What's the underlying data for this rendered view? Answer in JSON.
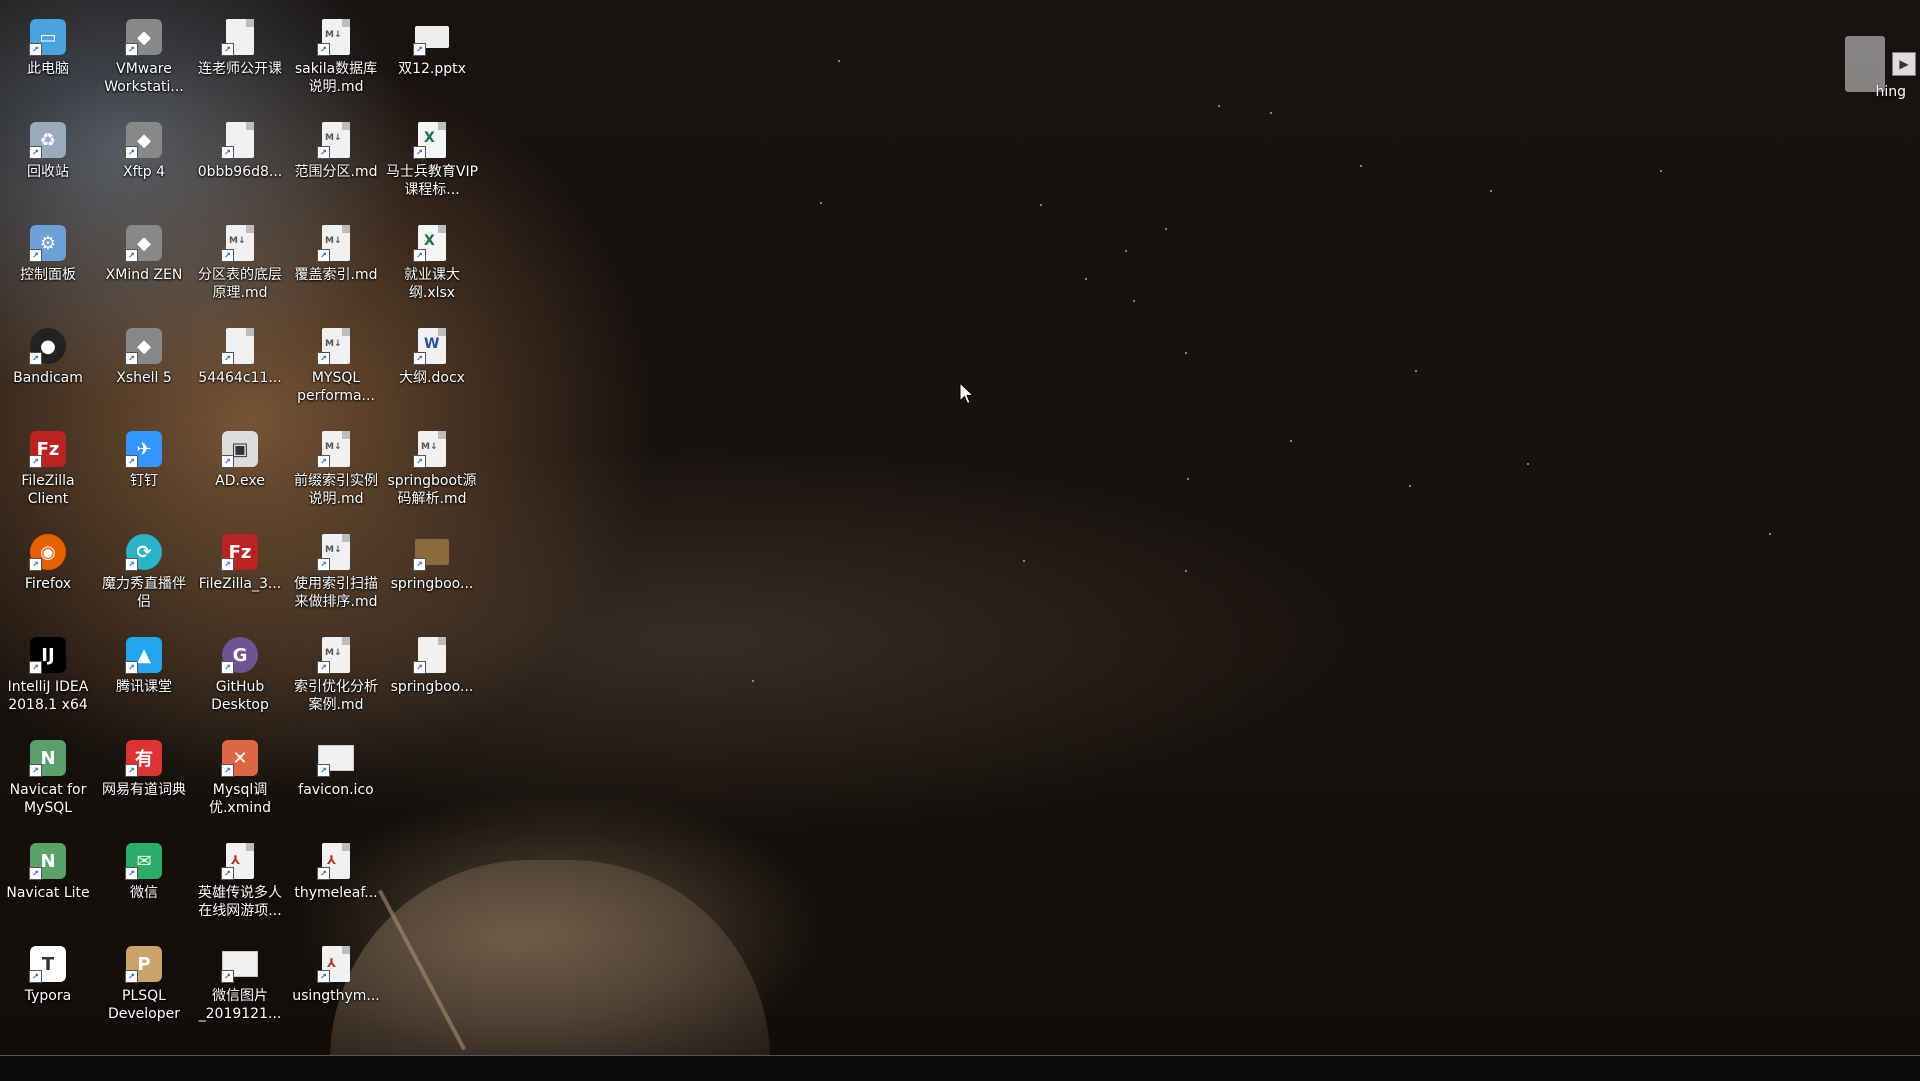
{
  "desktop": {
    "icons": [
      {
        "label": "此电脑",
        "icon": "computer-icon",
        "col": 0,
        "row": 0
      },
      {
        "label": "VMware Workstati...",
        "icon": "vmware-icon",
        "col": 1,
        "row": 0
      },
      {
        "label": "连老师公开课",
        "icon": "file-icon",
        "col": 2,
        "row": 0
      },
      {
        "label": "sakila数据库说明.md",
        "icon": "markdown-file-icon",
        "col": 3,
        "row": 0
      },
      {
        "label": "双12.pptx",
        "icon": "pptx-file-icon",
        "col": 4,
        "row": 0
      },
      {
        "label": "回收站",
        "icon": "recycle-bin-icon",
        "col": 0,
        "row": 1
      },
      {
        "label": "Xftp 4",
        "icon": "xftp-icon",
        "col": 1,
        "row": 1
      },
      {
        "label": "0bbb96d8...",
        "icon": "file-icon",
        "col": 2,
        "row": 1
      },
      {
        "label": "范围分区.md",
        "icon": "markdown-file-icon",
        "col": 3,
        "row": 1
      },
      {
        "label": "马士兵教育VIP课程标...",
        "icon": "excel-file-icon",
        "col": 4,
        "row": 1
      },
      {
        "label": "控制面板",
        "icon": "control-panel-icon",
        "col": 0,
        "row": 2
      },
      {
        "label": "XMind ZEN",
        "icon": "xmind-icon",
        "col": 1,
        "row": 2
      },
      {
        "label": "分区表的底层原理.md",
        "icon": "markdown-file-icon",
        "col": 2,
        "row": 2
      },
      {
        "label": "覆盖索引.md",
        "icon": "markdown-file-icon",
        "col": 3,
        "row": 2
      },
      {
        "label": "就业课大纲.xlsx",
        "icon": "excel-file-icon",
        "col": 4,
        "row": 2
      },
      {
        "label": "Bandicam",
        "icon": "bandicam-icon",
        "col": 0,
        "row": 3
      },
      {
        "label": "Xshell 5",
        "icon": "xshell-icon",
        "col": 1,
        "row": 3
      },
      {
        "label": "54464c11...",
        "icon": "file-icon",
        "col": 2,
        "row": 3
      },
      {
        "label": "MYSQL performa...",
        "icon": "markdown-file-icon",
        "col": 3,
        "row": 3
      },
      {
        "label": "大纲.docx",
        "icon": "word-file-icon",
        "col": 4,
        "row": 3
      },
      {
        "label": "FileZilla Client",
        "icon": "filezilla-icon",
        "col": 0,
        "row": 4
      },
      {
        "label": "钉钉",
        "icon": "dingtalk-icon",
        "col": 1,
        "row": 4
      },
      {
        "label": "AD.exe",
        "icon": "exe-icon",
        "col": 2,
        "row": 4
      },
      {
        "label": "前缀索引实例说明.md",
        "icon": "markdown-file-icon",
        "col": 3,
        "row": 4
      },
      {
        "label": "springboot源码解析.md",
        "icon": "markdown-file-icon",
        "col": 4,
        "row": 4
      },
      {
        "label": "Firefox",
        "icon": "firefox-icon",
        "col": 0,
        "row": 5
      },
      {
        "label": "魔力秀直播伴侣",
        "icon": "live-assistant-icon",
        "col": 1,
        "row": 5
      },
      {
        "label": "FileZilla_3...",
        "icon": "filezilla-icon",
        "col": 2,
        "row": 5
      },
      {
        "label": "使用索引扫描来做排序.md",
        "icon": "markdown-file-icon",
        "col": 3,
        "row": 5
      },
      {
        "label": "springboo...",
        "icon": "archive-icon",
        "col": 4,
        "row": 5
      },
      {
        "label": "IntelliJ IDEA 2018.1 x64",
        "icon": "intellij-icon",
        "col": 0,
        "row": 6
      },
      {
        "label": "腾讯课堂",
        "icon": "tencent-classroom-icon",
        "col": 1,
        "row": 6
      },
      {
        "label": "GitHub Desktop",
        "icon": "github-icon",
        "col": 2,
        "row": 6
      },
      {
        "label": "索引优化分析案例.md",
        "icon": "markdown-file-icon",
        "col": 3,
        "row": 6
      },
      {
        "label": "springboo...",
        "icon": "file-icon",
        "col": 4,
        "row": 6
      },
      {
        "label": "Navicat for MySQL",
        "icon": "navicat-icon",
        "col": 0,
        "row": 7
      },
      {
        "label": "网易有道词典",
        "icon": "youdao-icon",
        "col": 1,
        "row": 7
      },
      {
        "label": "Mysql调优.xmind",
        "icon": "xmind-file-icon",
        "col": 2,
        "row": 7
      },
      {
        "label": "favicon.ico",
        "icon": "image-file-icon",
        "col": 3,
        "row": 7
      },
      {
        "label": "Navicat Lite",
        "icon": "navicat-icon",
        "col": 0,
        "row": 8
      },
      {
        "label": "微信",
        "icon": "wechat-icon",
        "col": 1,
        "row": 8
      },
      {
        "label": "英雄传说多人在线网游项...",
        "icon": "pdf-file-icon",
        "col": 2,
        "row": 8
      },
      {
        "label": "thymeleaf...",
        "icon": "pdf-file-icon",
        "col": 3,
        "row": 8
      },
      {
        "label": "Typora",
        "icon": "typora-icon",
        "col": 0,
        "row": 9
      },
      {
        "label": "PLSQL Developer",
        "icon": "plsql-icon",
        "col": 1,
        "row": 9
      },
      {
        "label": "微信图片_2019121...",
        "icon": "image-file-icon",
        "col": 2,
        "row": 9
      },
      {
        "label": "usingthym...",
        "icon": "pdf-file-icon",
        "col": 3,
        "row": 9
      }
    ]
  },
  "tray_widget": {
    "label": "hing",
    "icon": "recording-widget-icon"
  },
  "colors": {
    "label_text": "#ffffff",
    "taskbar": "#0c0a09"
  }
}
